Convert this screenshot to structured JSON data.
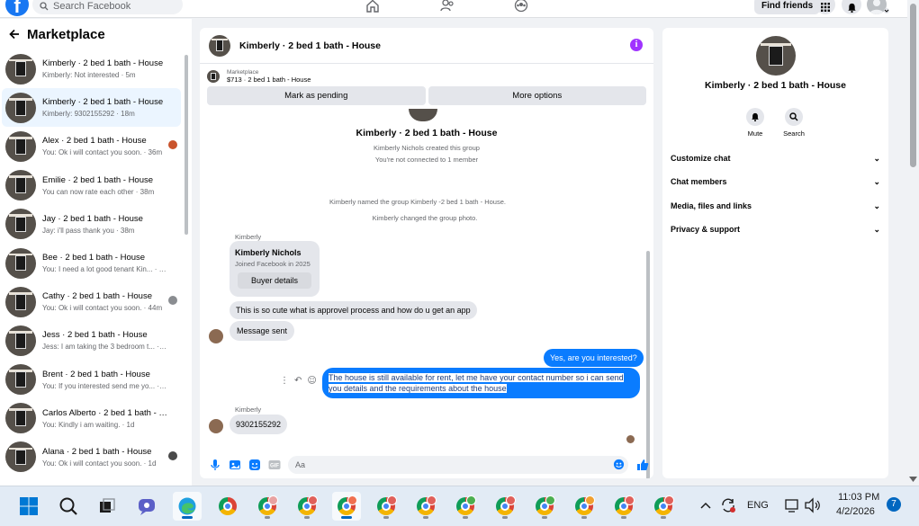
{
  "topbar": {
    "search_placeholder": "Search Facebook",
    "find_friends": "Find friends"
  },
  "sidebar": {
    "title": "Marketplace",
    "conversations": [
      {
        "name": "Kimberly · 2 bed 1 bath - House",
        "preview": "Kimberly: Not interested · 5m",
        "active": false
      },
      {
        "name": "Kimberly · 2 bed 1 bath - House",
        "preview": "Kimberly: 9302155292 · 18m",
        "active": true
      },
      {
        "name": "Alex · 2 bed 1 bath - House",
        "preview": "You: Ok i will contact you soon. · 36m",
        "badge": "#c9532c"
      },
      {
        "name": "Emilie · 2 bed 1 bath - House",
        "preview": "You can now rate each other · 38m"
      },
      {
        "name": "Jay · 2 bed 1 bath - House",
        "preview": "Jay: i'll pass thank you · 38m"
      },
      {
        "name": "Bee · 2 bed 1 bath - House",
        "preview": "You: I need a lot good tenant Kin... · 40m"
      },
      {
        "name": "Cathy · 2 bed 1 bath - House",
        "preview": "You: Ok i will contact you soon. · 44m",
        "badge": "#8a8d91"
      },
      {
        "name": "Jess · 2 bed 1 bath - House",
        "preview": "Jess: I am taking the 3 bedroom t... · 54m"
      },
      {
        "name": "Brent · 2 bed 1 bath - House",
        "preview": "You: If you interested send me yo... · 55m"
      },
      {
        "name": "Carlos Alberto · 2 bed 1 bath - H...",
        "preview": "You: Kindly i am waiting. · 1d"
      },
      {
        "name": "Alana · 2 bed 1 bath - House",
        "preview": "You: Ok i will contact you soon. · 1d",
        "badge": "#4a4a4a"
      }
    ]
  },
  "chat": {
    "title": "Kimberly · 2 bed 1 bath - House",
    "marketplace_label": "Marketplace",
    "listing": "$713 · 2 bed 1 bath - House",
    "mark_pending": "Mark as pending",
    "more_options": "More options",
    "group_title": "Kimberly · 2 bed 1 bath - House",
    "created": "Kimberly Nichols created this group",
    "not_connected": "You're not connected to 1 member",
    "named_group": "Kimberly named the group Kimberly -2 bed 1 bath - House.",
    "changed_photo": "Kimberly changed the group photo.",
    "sender_1": "Kimberly",
    "card_name": "Kimberly Nichols",
    "card_joined": "Joined Facebook in 2025",
    "buyer_details": "Buyer details",
    "msg_1": "This is so cute what is approvel process and how do u get an app",
    "msg_2": "Message sent",
    "out_1": "Yes, are you interested?",
    "out_2": "The house is still available for rent, let me have your contact number so i can send you details and the requirements about the house",
    "sender_2": "Kimberly",
    "msg_3": "9302155292",
    "composer_placeholder": "Aa"
  },
  "rpanel": {
    "title": "Kimberly · 2 bed 1 bath - House",
    "mute": "Mute",
    "search": "Search",
    "rows": [
      "Customize chat",
      "Chat members",
      "Media, files and links",
      "Privacy & support"
    ]
  },
  "taskbar": {
    "lang": "ENG",
    "time": "11:03 PM",
    "date": "4/2/2026",
    "notifications": "7",
    "chrome_badges": [
      "#e8a2a2",
      "#e0605a",
      "#f07050",
      "#e0605a",
      "#e0605a",
      "#4caf50",
      "#e0605a",
      "#4caf50",
      "#f0a030",
      "#e0605a",
      "#e0605a"
    ]
  },
  "colors": {
    "facebook_blue": "#1877f2",
    "messenger_blue": "#0a7cff",
    "info_purple": "#a033ff"
  }
}
